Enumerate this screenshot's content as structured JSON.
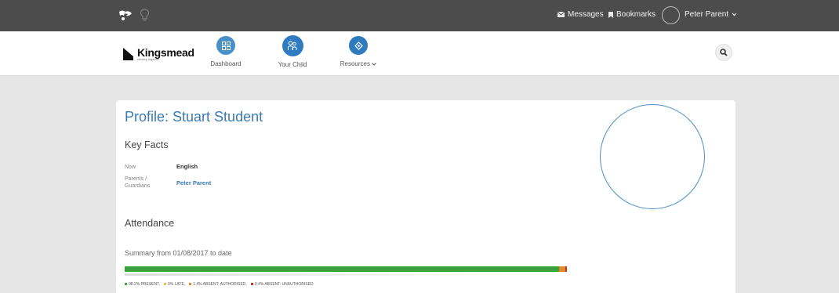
{
  "topbar": {
    "messages_label": "Messages",
    "bookmarks_label": "Bookmarks",
    "user_name": "Peter Parent"
  },
  "nav": {
    "brand_name": "Kingsmead",
    "brand_tagline": "striving together",
    "items": [
      {
        "label": "Dashboard",
        "icon": "grid-icon",
        "color": "#4a90c8"
      },
      {
        "label": "Your Child",
        "icon": "children-icon",
        "color": "#2f7bbf"
      },
      {
        "label": "Resources",
        "icon": "puzzle-icon",
        "color": "#2f7bbf"
      }
    ]
  },
  "profile": {
    "title": "Profile: Stuart Student",
    "key_facts_heading": "Key Facts",
    "facts": [
      {
        "label": "Now",
        "value": "English"
      },
      {
        "label": "Parents / Guardians",
        "value": "Peter Parent"
      }
    ]
  },
  "attendance": {
    "heading": "Attendance",
    "summary": "Summary from 01/08/2017 to date",
    "segments": [
      {
        "label": "98.2% PRESENT",
        "percent": 98.2,
        "color": "#3aa23a"
      },
      {
        "label": "0% LATE",
        "percent": 0,
        "color": "#e8c23a"
      },
      {
        "label": "1.4% ABSENT: AUTHORISED",
        "percent": 1.4,
        "color": "#e28a2a"
      },
      {
        "label": "0.4% ABSENT: UNAUTHORISED",
        "percent": 0.4,
        "color": "#c0392b"
      }
    ]
  },
  "colors": {
    "topbar_bg": "#4c4c4c",
    "accent": "#3a7ab3",
    "page_bg": "#e6e6e6"
  }
}
